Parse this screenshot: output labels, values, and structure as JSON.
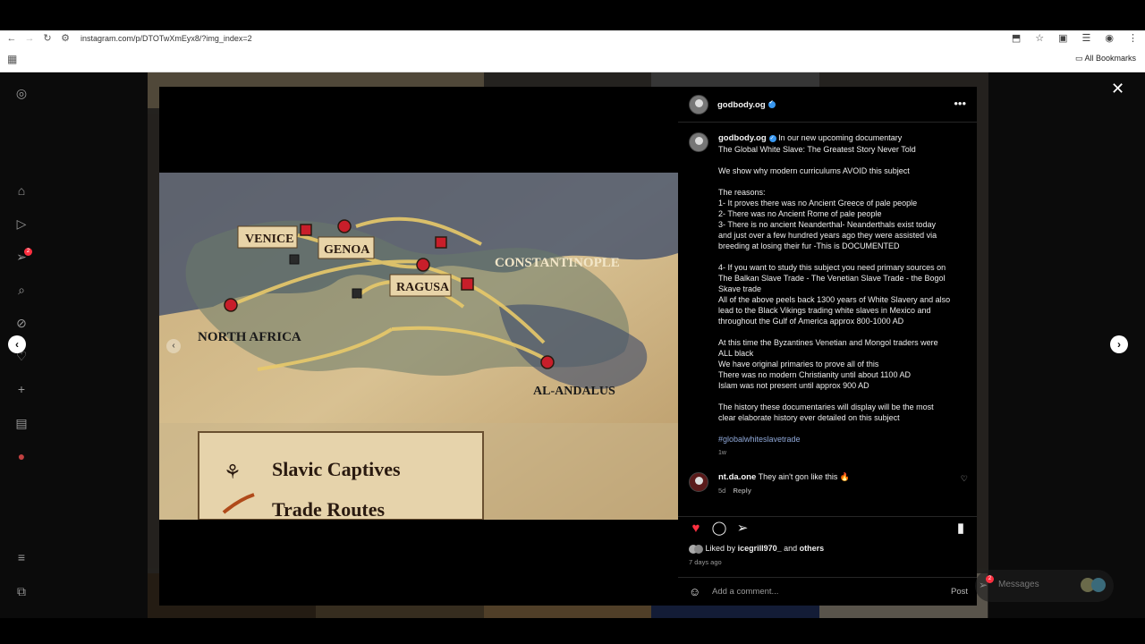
{
  "browser": {
    "url": "instagram.com/p/DTOTwXmEyx8/?img_index=2",
    "all_bookmarks": "All Bookmarks"
  },
  "post": {
    "username": "godbody.og",
    "caption": [
      "In our new upcoming documentary",
      "The Global White Slave: The Greatest Story Never Told",
      "",
      "We show why modern curriculums AVOID this subject",
      "",
      "The reasons:",
      "1- It proves there was no Ancient Greece of pale people",
      "2- There was no Ancient Rome of pale people",
      "3- There is no ancient Neanderthal- Neanderthals exist today",
      "and just over a few hundred years ago they were assisted via",
      "breeding at losing their fur -This is DOCUMENTED",
      "",
      "4- If you want to study this subject you need primary sources on",
      "The Balkan Slave Trade - The Venetian Slave Trade - the Bogol",
      "Skave trade",
      "All of the above peels back 1300 years of White Slavery and also",
      "lead to the Black Vikings trading white slaves in Mexico and",
      "throughout the Gulf of America approx 800-1000 AD",
      "",
      "At this time the Byzantines Venetian and Mongol traders were",
      "ALL black",
      "We have original primaries to prove all of this",
      "There was no modern Christianity until about 1100 AD",
      "Islam was not present until approx 900 AD",
      "",
      "The history these documentaries will display will be the most",
      "clear elaborate history ever detailed on this subject"
    ],
    "hashtag": "#globalwhiteslavetrade",
    "caption_time": "1w",
    "comment": {
      "username": "nt.da.one",
      "text": "They ain't gon like this 🔥",
      "time": "5d",
      "reply": "Reply"
    },
    "liked_by_prefix": "Liked by",
    "liked_by_user": "icegrill970_",
    "liked_by_and": "and",
    "liked_by_others": "others",
    "post_time": "7 days ago",
    "add_comment_placeholder": "Add a comment...",
    "post_button": "Post"
  },
  "map": {
    "labels": [
      "VENICE",
      "GENOA",
      "RAGUSA",
      "CONSTANTINOPLE",
      "NORTH AFRICA",
      "AL-ANDALUS"
    ],
    "legend": [
      "Slavic Captives",
      "Trade Routes"
    ]
  },
  "messages": {
    "label": "Messages",
    "badge": "2"
  },
  "sidebar_badge": "2",
  "icons": [
    "instagram-icon",
    "home-icon",
    "reels-icon",
    "send-icon",
    "search-icon",
    "explore-icon",
    "heart-icon",
    "create-icon",
    "dashboard-icon",
    "threads-icon",
    "menu-icon",
    "meta-icon"
  ]
}
